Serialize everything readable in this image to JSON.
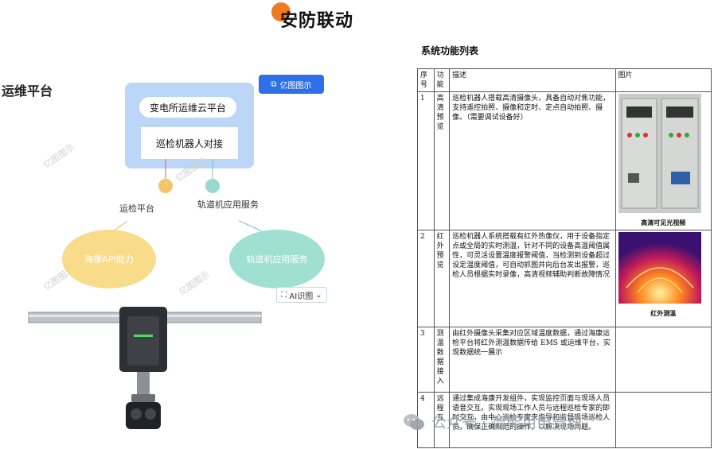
{
  "header": {
    "title": "安防联动"
  },
  "diagram": {
    "section_label": "运维平台",
    "badge": "亿图图示",
    "cloud_platform": "变电所运维云平台",
    "robot_dock": "巡检机器人对接",
    "watermark": "亿图图示",
    "left_node_label": "运检平台",
    "right_node_label": "轨道机应用服务",
    "left_ellipse": "海康API能力",
    "right_ellipse": "轨道机应用服务",
    "ai_chip": "AI识图",
    "colors": {
      "cloud": "#bcd6f7",
      "left_dot": "#f5c56b",
      "right_dot": "#9ad9cf",
      "left_ellipse": "#f9dc8a",
      "right_ellipse": "#9fe0d3"
    }
  },
  "table": {
    "title": "系统功能列表",
    "headers": [
      "序号",
      "功能",
      "描述",
      "图片"
    ],
    "rows": [
      {
        "no": "1",
        "func": "高清预览",
        "desc": "巡检机器人搭载高清摄像头，具备自动对焦功能，支持遥控拍照、摄像和定时、定点自动拍照、摄像。（需要调试设备好）",
        "caption": "高清可见光视频"
      },
      {
        "no": "2",
        "func": "红外预览",
        "desc": "巡检机器人系统搭载有红外热像仪，用于设备指定点或全局的实时测温，针对不同的设备高温阈值属性，可灵活设置温度报警阈值，当检测到设备超过设定温度阈值，可自动抓图并向后台发出报警，巡检人员根据实时录像，高清视频辅助判断故障情况",
        "caption": "红外测温"
      },
      {
        "no": "3",
        "func": "测温数据接入",
        "desc": "由红外摄像头采集对应区域温度数据，通过海康运检平台将红外测温数据传给 EMS 或运维平台，实现数据统一展示",
        "caption": ""
      },
      {
        "no": "4",
        "func": "远程互",
        "desc": "通过集成海康开发组件，实现监控页面与现场人员语音交互。实现现场工作人员与远程巡检专家的即时交互，由中心巡检专家来指导和监督现场巡检人员，确保正确规范的操作，以解决现场问题。",
        "caption": ""
      }
    ]
  },
  "footer": {
    "watermark": "公众号 · 智能用电管理"
  }
}
